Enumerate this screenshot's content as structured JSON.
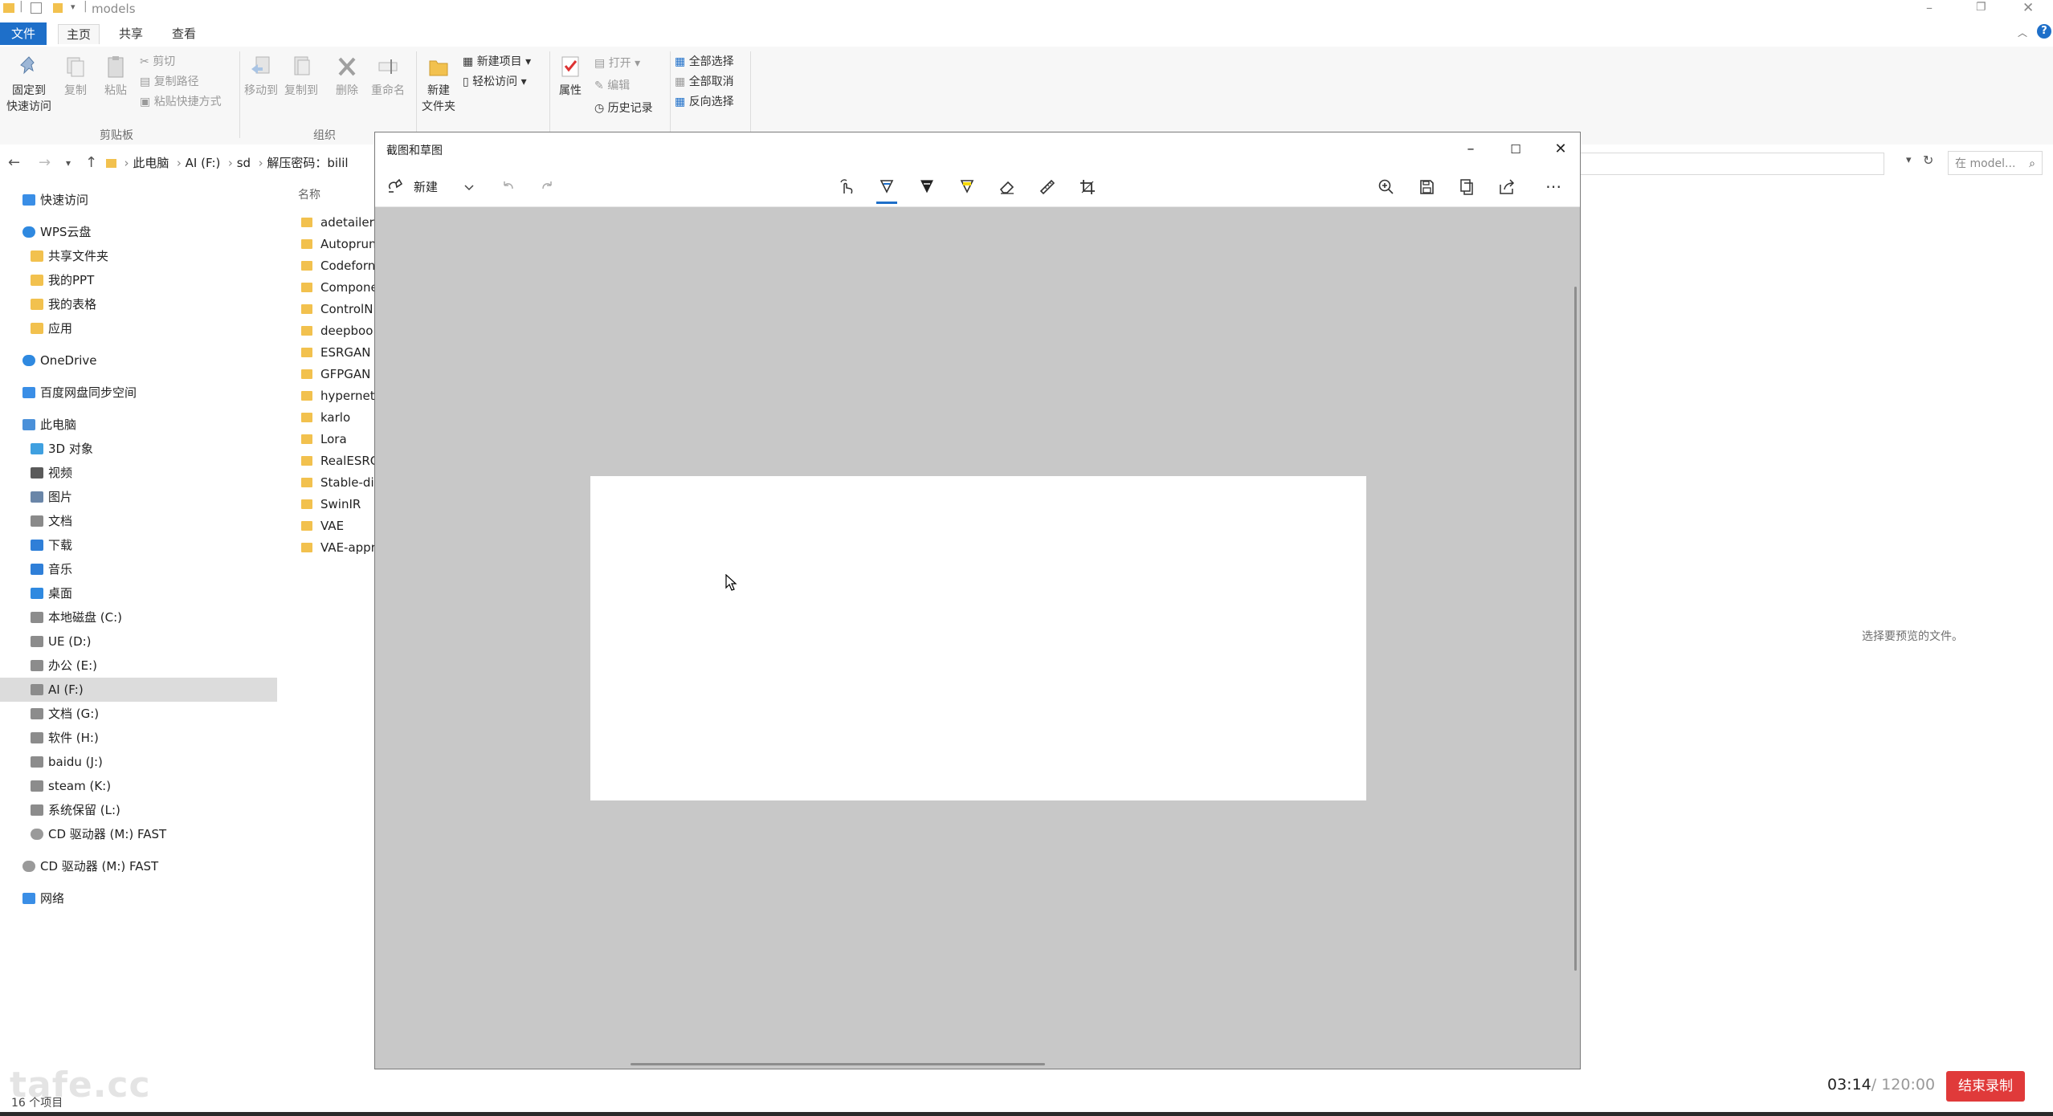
{
  "explorer": {
    "title": "models",
    "ribbon_tabs": [
      "文件",
      "主页",
      "共享",
      "查看"
    ],
    "clipboard": {
      "pin": "固定到",
      "pin2": "快速访问",
      "copy": "复制",
      "paste": "粘贴",
      "cut": "剪切",
      "copy_path": "复制路径",
      "paste_shortcut": "粘贴快捷方式",
      "group": "剪贴板"
    },
    "organize": {
      "move_to": "移动到",
      "copy_to": "复制到",
      "delete": "删除",
      "rename": "重命名",
      "group": "组织"
    },
    "new": {
      "new_item": "新建项目",
      "easy_access": "轻松访问",
      "new_folder": "新建",
      "new_folder2": "文件夹"
    },
    "open": {
      "properties": "属性",
      "open": "打开",
      "edit": "编辑",
      "history": "历史记录"
    },
    "select": {
      "select_all": "全部选择",
      "select_none": "全部取消",
      "invert": "反向选择"
    },
    "address": {
      "crumbs": [
        "此电脑",
        "AI (F:)",
        "sd",
        "解压密码：bilil"
      ]
    },
    "search_placeholder": "在 model...",
    "nav": [
      {
        "label": "快速访问",
        "icon": "star-icon",
        "level": 0
      },
      {
        "label": "WPS云盘",
        "icon": "cloud-icon",
        "level": 0
      },
      {
        "label": "共享文件夹",
        "icon": "folder-icon",
        "level": 1
      },
      {
        "label": "我的PPT",
        "icon": "folder-icon",
        "level": 1
      },
      {
        "label": "我的表格",
        "icon": "folder-icon",
        "level": 1
      },
      {
        "label": "应用",
        "icon": "folder-icon",
        "level": 1
      },
      {
        "label": "OneDrive",
        "icon": "cloud-icon",
        "level": 0
      },
      {
        "label": "百度网盘同步空间",
        "icon": "baidu-icon",
        "level": 0
      },
      {
        "label": "此电脑",
        "icon": "pc-icon",
        "level": 0
      },
      {
        "label": "3D 对象",
        "icon": "cube-icon",
        "level": 1
      },
      {
        "label": "视频",
        "icon": "video-icon",
        "level": 1
      },
      {
        "label": "图片",
        "icon": "image-icon",
        "level": 1
      },
      {
        "label": "文档",
        "icon": "document-icon",
        "level": 1
      },
      {
        "label": "下载",
        "icon": "download-icon",
        "level": 1
      },
      {
        "label": "音乐",
        "icon": "music-icon",
        "level": 1
      },
      {
        "label": "桌面",
        "icon": "desktop-icon",
        "level": 1
      },
      {
        "label": "本地磁盘 (C:)",
        "icon": "drive-icon",
        "level": 1
      },
      {
        "label": "UE (D:)",
        "icon": "drive-icon",
        "level": 1
      },
      {
        "label": "办公 (E:)",
        "icon": "drive-icon",
        "level": 1
      },
      {
        "label": "AI (F:)",
        "icon": "drive-icon",
        "level": 1,
        "selected": true
      },
      {
        "label": "文档 (G:)",
        "icon": "drive-icon",
        "level": 1
      },
      {
        "label": "软件 (H:)",
        "icon": "drive-icon",
        "level": 1
      },
      {
        "label": "baidu (J:)",
        "icon": "drive-icon",
        "level": 1
      },
      {
        "label": "steam (K:)",
        "icon": "drive-icon",
        "level": 1
      },
      {
        "label": "系统保留 (L:)",
        "icon": "drive-icon",
        "level": 1
      },
      {
        "label": "CD 驱动器 (M:) FAST",
        "icon": "cd-icon",
        "level": 1
      },
      {
        "label": "CD 驱动器 (M:) FAST",
        "icon": "cd-icon",
        "level": 0
      },
      {
        "label": "网络",
        "icon": "network-icon",
        "level": 0
      }
    ],
    "column_header": "名称",
    "files": [
      "adetailer",
      "Autoprun",
      "Codeforn",
      "Compone",
      "ControlN",
      "deepboo",
      "ESRGAN",
      "GFPGAN",
      "hypernet",
      "karlo",
      "Lora",
      "RealESRG",
      "Stable-di",
      "SwinIR",
      "VAE",
      "VAE-appr"
    ],
    "preview_text": "选择要预览的文件。",
    "status": "16 个项目"
  },
  "snip": {
    "title": "截图和草图",
    "new_label": "新建"
  },
  "recorder": {
    "elapsed": "03:14",
    "total": "/ 120:00",
    "stop": "结束录制"
  },
  "watermark": "tafe.cc",
  "colors": {
    "accent": "#1e6fc9",
    "canvas_bg": "#c8c8c8",
    "stop_red": "#e03a3a",
    "folder": "#f2c14e"
  }
}
